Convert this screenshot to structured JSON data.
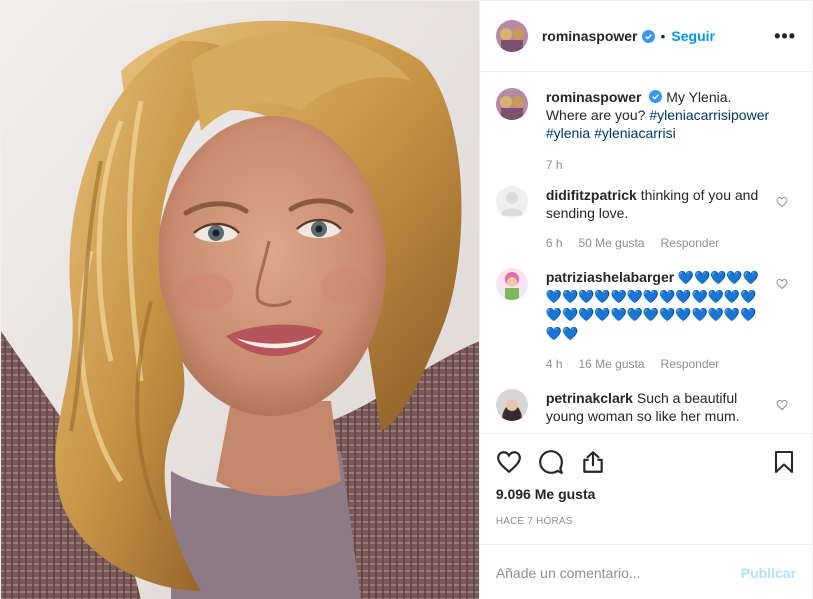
{
  "header": {
    "username": "rominaspower",
    "follow_label": "Seguir",
    "more_label": "•••"
  },
  "caption": {
    "username": "rominaspower",
    "text": "My Ylenia. Where are you?",
    "hashtags": [
      "#yleniacarrisipower",
      "#ylenia",
      "#yleniacarrisi"
    ],
    "time": "7 h"
  },
  "comments": [
    {
      "username": "didifitzpatrick",
      "text": "thinking of you and sending love.",
      "time": "6 h",
      "likes": "50 Me gusta",
      "reply": "Responder"
    },
    {
      "username": "patriziashelabarger",
      "text": "💙💙💙💙💙💙💙💙💙💙💙💙💙💙💙💙💙💙💙💙💙💙💙💙💙💙💙💙💙💙💙💙💙",
      "time": "4 h",
      "likes": "16 Me gusta",
      "reply": "Responder"
    },
    {
      "username": "petrinakclark",
      "text": "Such a beautiful young woman so like her mum."
    }
  ],
  "footer": {
    "likes": "9.096 Me gusta",
    "ago": "HACE 7 HORAS",
    "comment_placeholder": "Añade un comentario...",
    "publish_label": "Publicar"
  },
  "colors": {
    "link": "#0095f6",
    "hashtag": "#00376b",
    "muted": "#8e8e8e",
    "heart_blue": "#1d8fe6"
  },
  "icons": {
    "like": "heart-icon",
    "comment": "comment-icon",
    "share": "share-icon",
    "save": "bookmark-icon",
    "verified": "verified-badge-icon"
  }
}
